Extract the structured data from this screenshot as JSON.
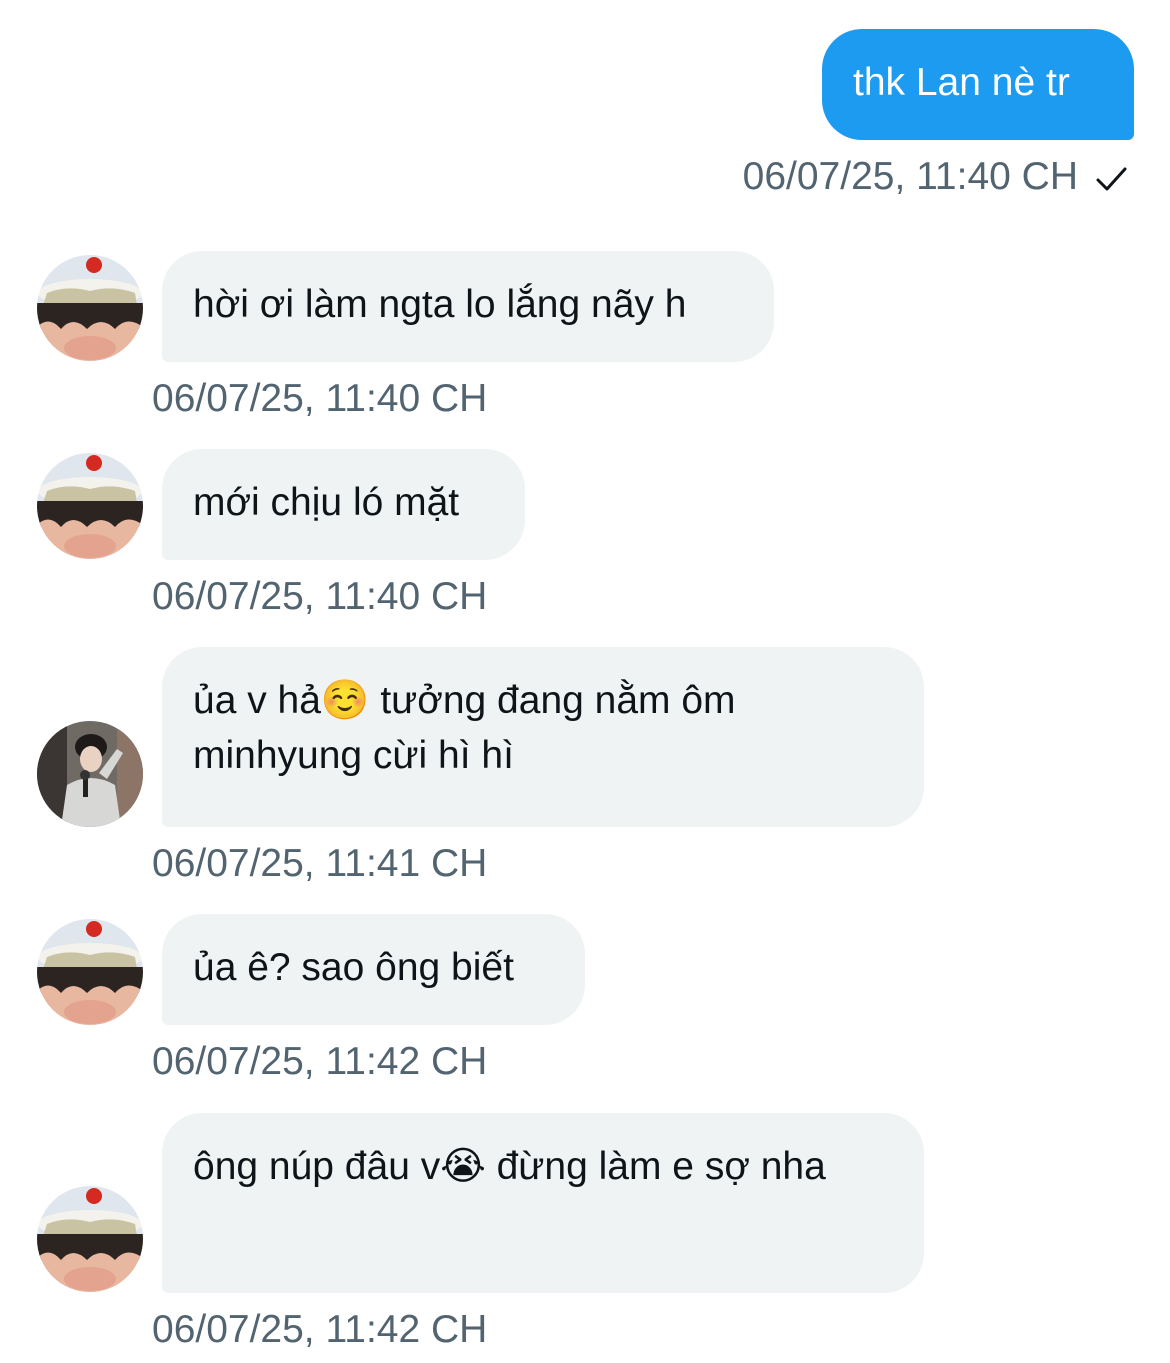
{
  "messages": [
    {
      "from": "me",
      "text": "thk Lan nè tr",
      "time": "06/07/25, 11:40 CH"
    },
    {
      "from": "them",
      "avatar": "avatar-cake-face",
      "text": "hời ơi làm ngta lo lắng nãy h",
      "time": "06/07/25, 11:40 CH"
    },
    {
      "from": "them",
      "avatar": "avatar-cake-face",
      "text": "mới chịu ló mặt",
      "time": "06/07/25, 11:40 CH"
    },
    {
      "from": "them",
      "avatar": "avatar-person-mic",
      "text": "ủa v hả☺️  tưởng đang nằm ôm minhyung cừi hì hì",
      "time": "06/07/25, 11:41 CH"
    },
    {
      "from": "them",
      "avatar": "avatar-cake-face",
      "text": "ủa ê? sao ông biết",
      "time": "06/07/25, 11:42 CH"
    },
    {
      "from": "them",
      "avatar": "avatar-cake-face",
      "text": "ông núp đâu v😭  đừng làm e sợ nha",
      "time": "06/07/25, 11:42 CH"
    }
  ],
  "icons": {
    "sent_status": "check-icon"
  },
  "colors": {
    "outgoing": "#1d9bf0",
    "incoming": "#eff3f4",
    "timestamp": "#536471"
  }
}
